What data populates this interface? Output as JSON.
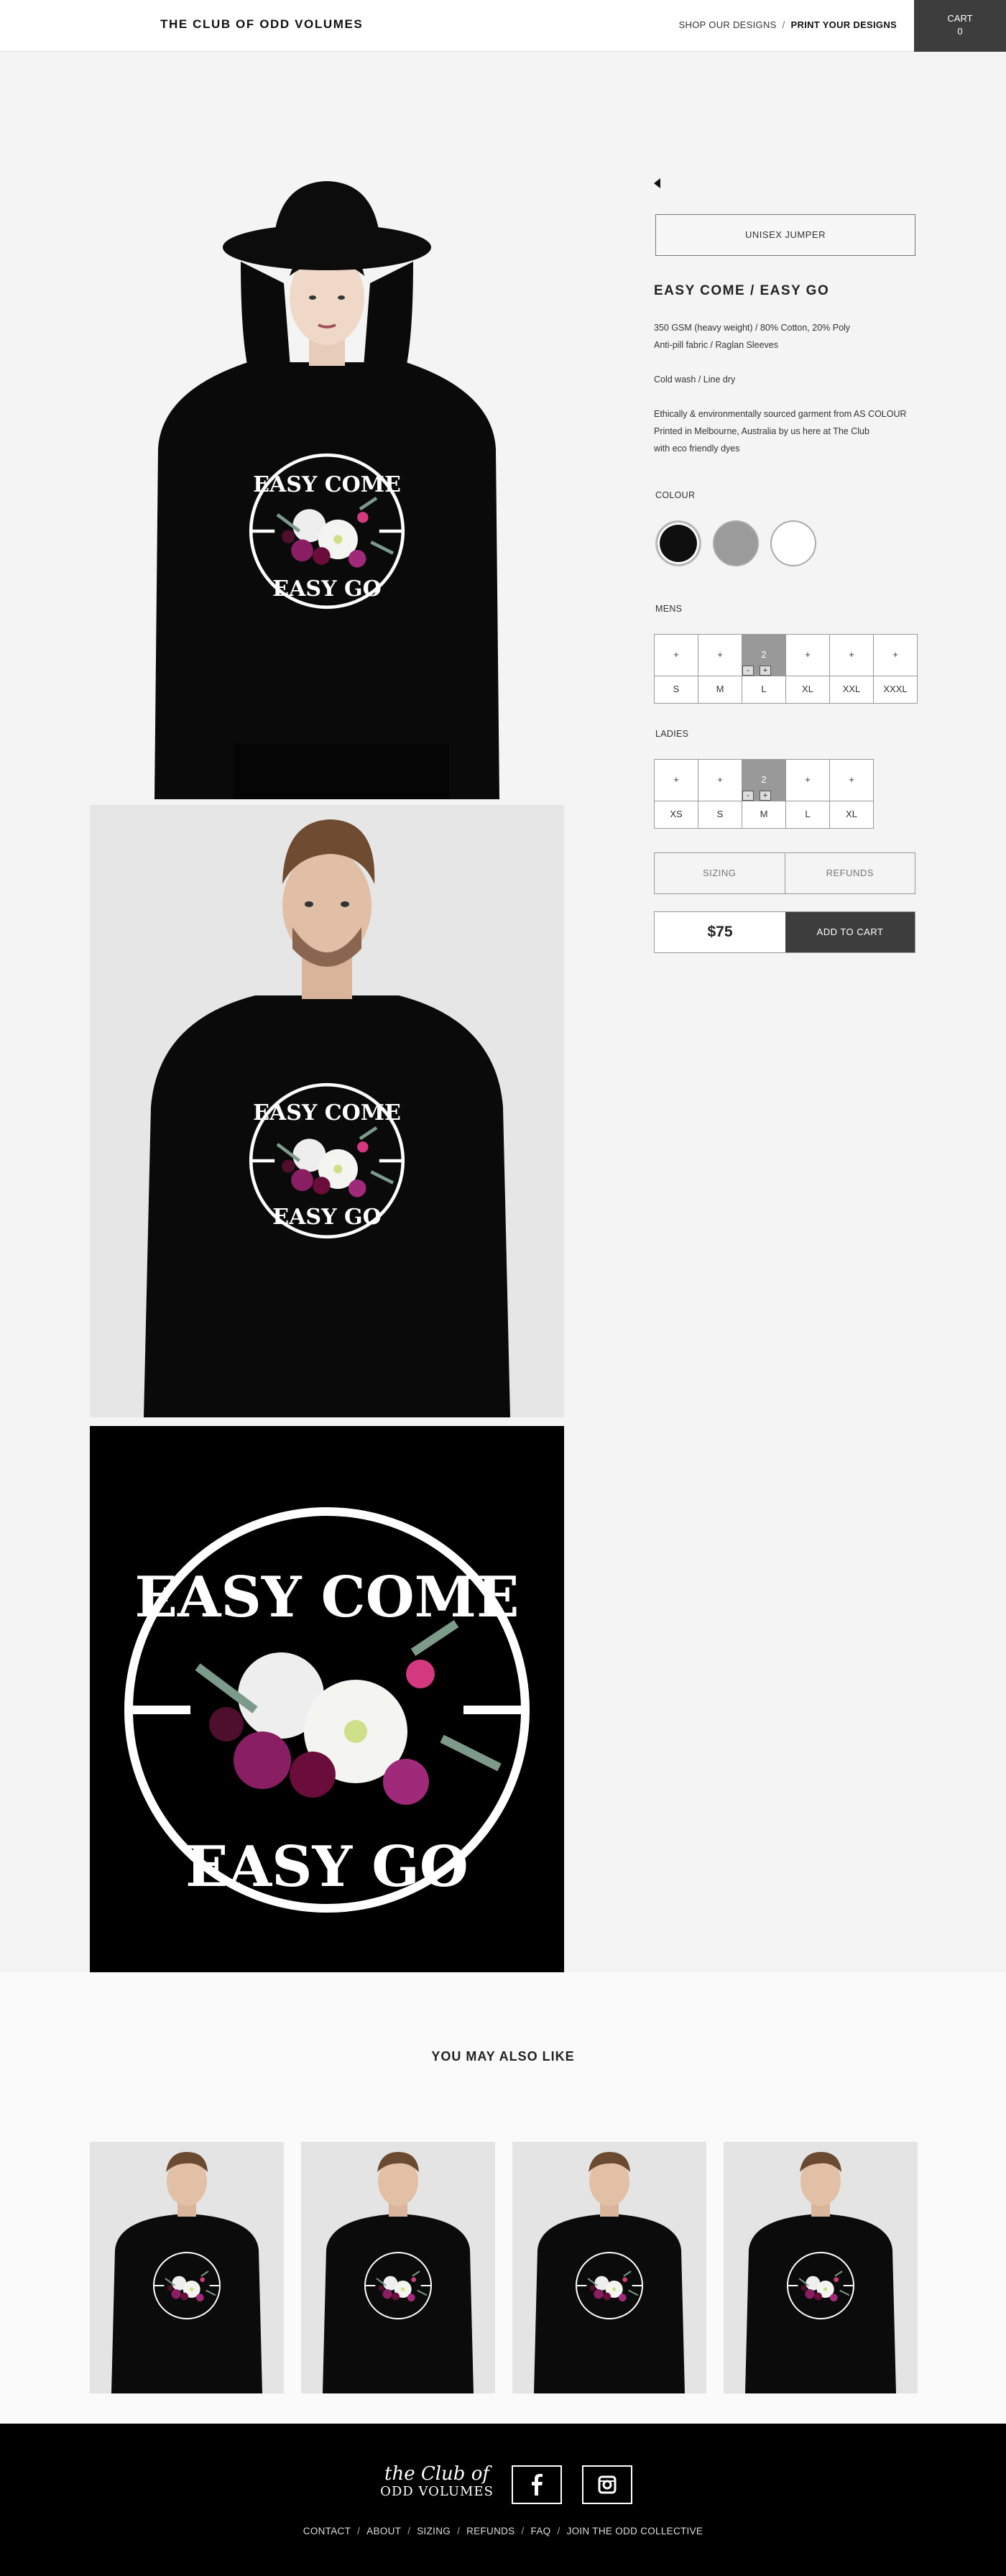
{
  "header": {
    "brand": "THE CLUB OF ODD VOLUMES",
    "nav_shop": "SHOP OUR DESIGNS",
    "nav_sep": "/",
    "nav_print": "PRINT YOUR DESIGNS",
    "cart_label": "CART",
    "cart_count": "0"
  },
  "graphic": {
    "line1": "EASY COME",
    "line2": "EASY GO"
  },
  "product": {
    "type": "UNISEX JUMPER",
    "title": "EASY COME / EASY GO",
    "desc_1a": "350 GSM (heavy weight) / 80% Cotton, 20% Poly",
    "desc_1b": "Anti-pill fabric / Raglan Sleeves",
    "desc_2": "Cold wash / Line dry",
    "desc_3a": "Ethically & environmentally sourced garment from AS COLOUR",
    "desc_3b": "Printed in Melbourne, Australia by us here at The Club",
    "desc_3c": "with eco friendly dyes",
    "colour_label": "COLOUR",
    "colours": [
      "#0f0f0f",
      "#9b9b9b",
      "#ffffff"
    ],
    "mens_label": "MENS",
    "mens": [
      {
        "qty": "+",
        "size": "S"
      },
      {
        "qty": "+",
        "size": "M"
      },
      {
        "qty": "2",
        "size": "L"
      },
      {
        "qty": "+",
        "size": "XL"
      },
      {
        "qty": "+",
        "size": "XXL"
      },
      {
        "qty": "+",
        "size": "XXXL"
      }
    ],
    "ladies_label": "LADIES",
    "ladies": [
      {
        "qty": "+",
        "size": "XS"
      },
      {
        "qty": "+",
        "size": "S"
      },
      {
        "qty": "2",
        "size": "M"
      },
      {
        "qty": "+",
        "size": "L"
      },
      {
        "qty": "+",
        "size": "XL"
      }
    ],
    "minus": "-",
    "plus": "+",
    "sizing": "SIZING",
    "refunds": "REFUNDS",
    "price": "$75",
    "add_to_cart": "ADD TO CART"
  },
  "related": {
    "title": "YOU MAY ALSO LIKE"
  },
  "footer": {
    "logo_line1": "the Club of",
    "logo_line2": "ODD VOLUMES",
    "links": [
      "CONTACT",
      "ABOUT",
      "SIZING",
      "REFUNDS",
      "FAQ",
      "JOIN THE ODD COLLECTIVE"
    ],
    "sep": "/"
  },
  "colors": {
    "dark": "#3d3d3d",
    "selected_qty": "#999999",
    "background": "#f4f4f4"
  }
}
